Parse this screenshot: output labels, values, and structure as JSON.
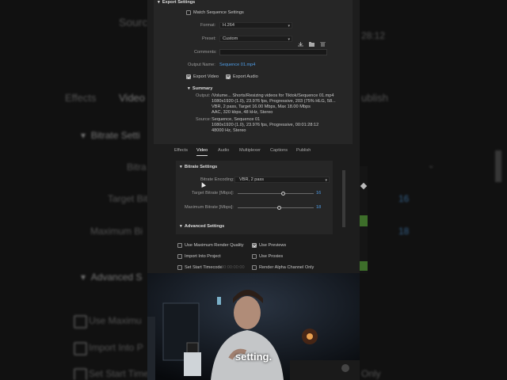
{
  "background": {
    "source_partial": "Sourc",
    "time_partial": "28:12",
    "tabs": [
      "Effects",
      "Video",
      "ublish"
    ],
    "bitrate_settings_partial": "Bitrate Setti",
    "bitrate_partial": "Bitra",
    "target_bitrate_partial": "Target Bitra",
    "maximum_bitrate_partial": "Maximum Bi",
    "target_value": "16",
    "maximum_value": "18",
    "advanced_partial": "Advanced S",
    "opts": [
      "Use Maximu",
      "Import Into P",
      "Set Start Time"
    ],
    "only_partial": "Only"
  },
  "export_settings": {
    "header": "Export Settings",
    "match_sequence": "Match Sequence Settings",
    "format_label": "Format:",
    "format_value": "H.264",
    "preset_label": "Preset:",
    "preset_value": "Custom",
    "comments_label": "Comments:",
    "output_name_label": "Output Name:",
    "output_name_value": "Sequence 01.mp4",
    "export_video": "Export Video",
    "export_audio": "Export Audio"
  },
  "summary": {
    "header": "Summary",
    "output_label": "Output:",
    "output_lines": [
      "/Volume... Shorts/Resizing videos for Tiktok/Sequence 01.mp4",
      "1080x1920 (1.0), 23.976 fps, Progressive, 203 (75% HLG, 58...",
      "VBR, 2 pass, Target 16.00 Mbps, Max 18.00 Mbps",
      "AAC, 320 kbps, 48 kHz, Stereo"
    ],
    "source_label": "Source:",
    "source_lines": [
      "Sequence, Sequence 01",
      "1080x1920 (1.0), 23.976 fps, Progressive, 00:01:28:12",
      "48000 Hz, Stereo"
    ]
  },
  "tabs": [
    "Effects",
    "Video",
    "Audio",
    "Multiplexer",
    "Captions",
    "Publish"
  ],
  "bitrate": {
    "header": "Bitrate Settings",
    "encoding_label": "Bitrate Encoding:",
    "encoding_value": "VBR, 2 pass",
    "target_label": "Target Bitrate [Mbps]:",
    "target_value": "16",
    "target_fraction": 0.6,
    "max_label": "Maximum Bitrate [Mbps]:",
    "max_value": "18",
    "max_fraction": 0.55
  },
  "advanced": {
    "header": "Advanced Settings"
  },
  "options": {
    "max_render": "Use Maximum Render Quality",
    "use_previews": "Use Previews",
    "import_project": "Import Into Project",
    "use_proxies": "Use Proxies",
    "set_timecode": "Set Start Timecode",
    "timecode_value": "00:00:00:00",
    "alpha_only": "Render Alpha Channel Only"
  },
  "caption": "setting.",
  "colors": {
    "accent": "#4f9ee8",
    "panel": "#262626",
    "dialog": "#1d1d1d"
  }
}
